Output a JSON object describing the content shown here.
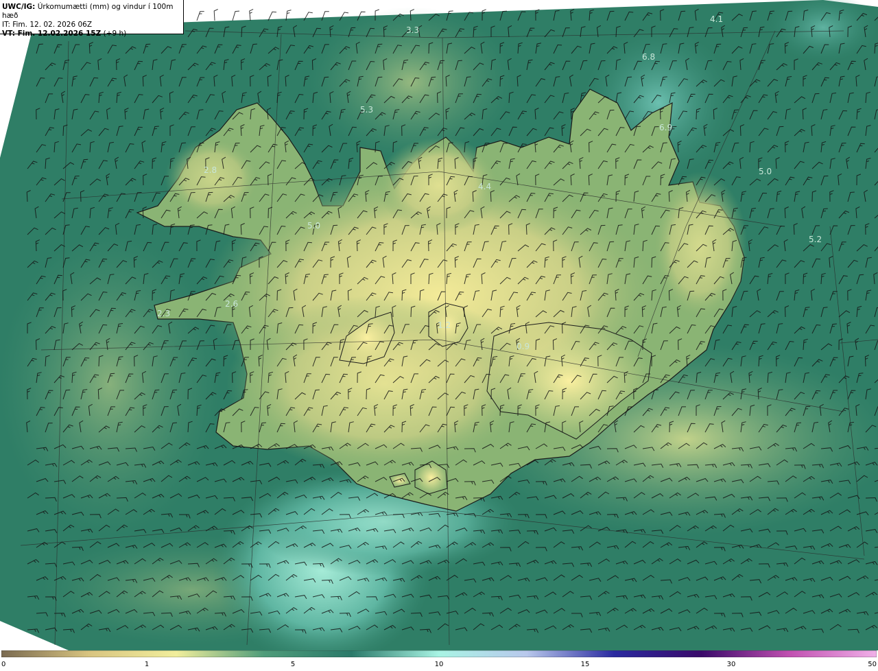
{
  "header": {
    "product": "UWC/IG:",
    "description": "Úrkomumætti (mm) og vindur í 100m hæð",
    "initial_time": "IT: Fim. 12. 02. 2026 06Z",
    "valid_label": "VT: Fim. 12.02.2026 15Z",
    "valid_offset": "(+9 h)"
  },
  "map_labels": [
    {
      "text": "3.3"
    },
    {
      "text": "4.1"
    },
    {
      "text": "6.8"
    },
    {
      "text": "5.3"
    },
    {
      "text": "6.9"
    },
    {
      "text": "5.0"
    },
    {
      "text": "2.8"
    },
    {
      "text": "4.4"
    },
    {
      "text": "5.0"
    },
    {
      "text": "5.2"
    },
    {
      "text": "2.6"
    },
    {
      "text": "2.3"
    },
    {
      "text": "1.2"
    },
    {
      "text": "0.9"
    }
  ],
  "colorbar": {
    "ticks": [
      {
        "label": "0",
        "value": 0
      },
      {
        "label": "1",
        "value": 1
      },
      {
        "label": "5",
        "value": 5
      },
      {
        "label": "10",
        "value": 10
      },
      {
        "label": "15",
        "value": 15
      },
      {
        "label": "30",
        "value": 30
      },
      {
        "label": "50",
        "value": 50
      }
    ],
    "colors": [
      "#7a6a50",
      "#d8c480",
      "#f1ee9c",
      "#4f9c7a",
      "#2b7a6a",
      "#a8f4e4",
      "#b8c8ec",
      "#2a2aa0",
      "#3a0a6a",
      "#c050b0",
      "#f0b0e8"
    ]
  },
  "colors": {
    "sea": "#2f7e66",
    "land_low": "#7fae70",
    "land_high": "#efe796",
    "coast": "#1a1a1a",
    "barb": "#141414"
  }
}
